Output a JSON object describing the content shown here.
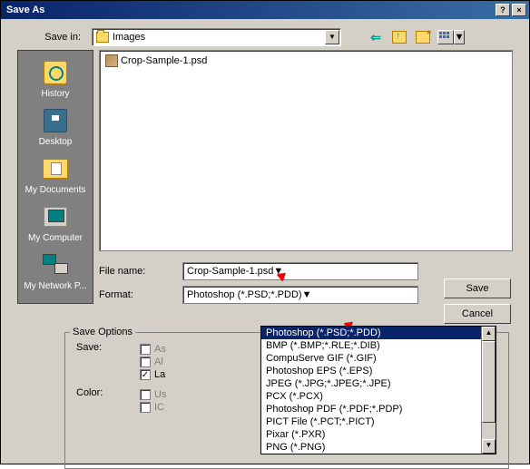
{
  "titlebar": {
    "title": "Save As",
    "help": "?",
    "close": "×"
  },
  "savein": {
    "label": "Save in:",
    "folder": "Images"
  },
  "places": [
    {
      "name": "history",
      "label": "History"
    },
    {
      "name": "desktop",
      "label": "Desktop"
    },
    {
      "name": "mydocs",
      "label": "My Documents"
    },
    {
      "name": "mycomputer",
      "label": "My Computer"
    },
    {
      "name": "mynetwork",
      "label": "My Network P..."
    }
  ],
  "files": [
    {
      "name": "Crop-Sample-1.psd"
    }
  ],
  "filename": {
    "label": "File name:",
    "value": "Crop-Sample-1.psd"
  },
  "format": {
    "label": "Format:",
    "value": "Photoshop (*.PSD;*.PDD)"
  },
  "format_options": [
    "Photoshop (*.PSD;*.PDD)",
    "BMP (*.BMP;*.RLE;*.DIB)",
    "CompuServe GIF (*.GIF)",
    "Photoshop EPS (*.EPS)",
    "JPEG (*.JPG;*.JPEG;*.JPE)",
    "PCX (*.PCX)",
    "Photoshop PDF (*.PDF;*.PDP)",
    "PICT File (*.PCT;*.PICT)",
    "Pixar (*.PXR)",
    "PNG (*.PNG)"
  ],
  "buttons": {
    "save": "Save",
    "cancel": "Cancel"
  },
  "save_options": {
    "title": "Save Options",
    "save_label": "Save:",
    "cb_as": "As",
    "cb_alpha": "Al",
    "cb_layers": "La",
    "color_label": "Color:",
    "cb_use": "Us",
    "cb_icc": "IC"
  }
}
